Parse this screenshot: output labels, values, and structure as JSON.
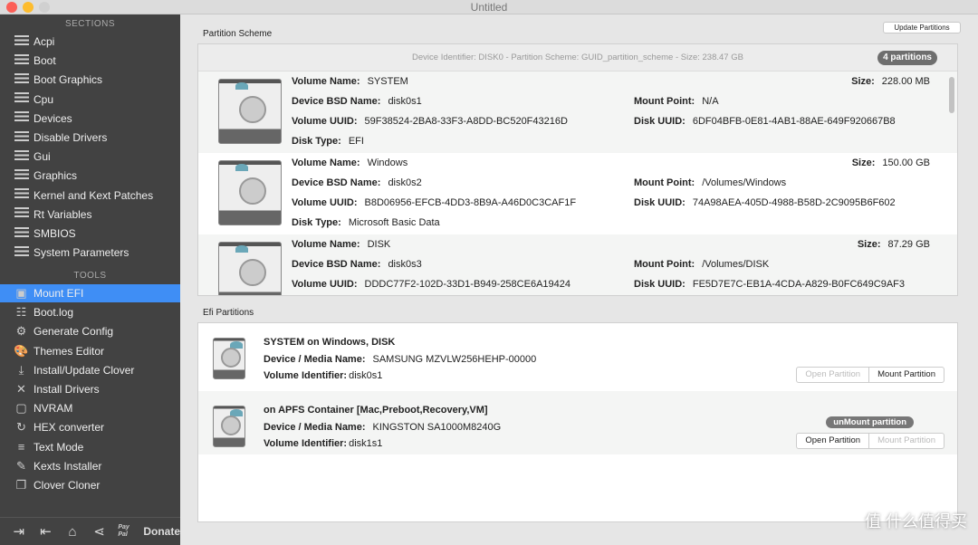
{
  "window": {
    "title": "Untitled"
  },
  "sidebar": {
    "sections_header": "SECTIONS",
    "sections": [
      "Acpi",
      "Boot",
      "Boot Graphics",
      "Cpu",
      "Devices",
      "Disable Drivers",
      "Gui",
      "Graphics",
      "Kernel and Kext Patches",
      "Rt Variables",
      "SMBIOS",
      "System Parameters"
    ],
    "tools_header": "TOOLS",
    "tools": [
      {
        "label": "Mount EFI",
        "icon": "mount-efi-icon",
        "selected": true
      },
      {
        "label": "Boot.log",
        "icon": "log-search-icon"
      },
      {
        "label": "Generate Config",
        "icon": "gears-icon"
      },
      {
        "label": "Themes Editor",
        "icon": "palette-icon"
      },
      {
        "label": "Install/Update Clover",
        "icon": "download-icon"
      },
      {
        "label": "Install Drivers",
        "icon": "tools-icon"
      },
      {
        "label": "NVRAM",
        "icon": "chip-icon"
      },
      {
        "label": "HEX converter",
        "icon": "refresh-icon"
      },
      {
        "label": "Text Mode",
        "icon": "text-lines-icon"
      },
      {
        "label": "Kexts Installer",
        "icon": "plug-icon"
      },
      {
        "label": "Clover Cloner",
        "icon": "copy-icon"
      }
    ],
    "footer": {
      "donate": "Donate",
      "paypal": "Pay Pal"
    },
    "accent": "#3f8ef5"
  },
  "toolbar": {
    "update_partitions": "Update Partitions"
  },
  "partition_scheme": {
    "label": "Partition Scheme",
    "header": "Device Identifier: DISK0 - Partition Scheme: GUID_partition_scheme - Size: 238.47 GB",
    "badge": "4 partitions",
    "keys": {
      "volume_name": "Volume Name:",
      "bsd": "Device BSD Name:",
      "uuid": "Volume UUID:",
      "disk_type": "Disk Type:",
      "size": "Size:",
      "mount": "Mount Point:",
      "disk_uuid": "Disk UUID:"
    },
    "partitions": [
      {
        "volume_name": "SYSTEM",
        "bsd": "disk0s1",
        "uuid": "59F38524-2BA8-33F3-A8DD-BC520F43216D",
        "disk_type": "EFI",
        "size": "228.00 MB",
        "mount": "N/A",
        "disk_uuid": "6DF04BFB-0E81-4AB1-88AE-649F920667B8"
      },
      {
        "volume_name": "Windows",
        "bsd": "disk0s2",
        "uuid": "B8D06956-EFCB-4DD3-8B9A-A46D0C3CAF1F",
        "disk_type": "Microsoft Basic Data",
        "size": "150.00 GB",
        "mount": "/Volumes/Windows",
        "disk_uuid": "74A98AEA-405D-4988-B58D-2C9095B6F602"
      },
      {
        "volume_name": "DISK",
        "bsd": "disk0s3",
        "uuid": "DDDC77F2-102D-33D1-B949-258CE6A19424",
        "size": "87.29 GB",
        "mount": "/Volumes/DISK",
        "disk_uuid": "FE5D7E7C-EB1A-4CDA-A829-B0FC649C9AF3"
      }
    ]
  },
  "efi": {
    "label": "Efi Partitions",
    "keys": {
      "media": "Device / Media Name:",
      "vid": "Volume Identifier:"
    },
    "open": "Open Partition",
    "mount": "Mount Partition",
    "unmount": "unMount partition",
    "items": [
      {
        "title": "SYSTEM on Windows, DISK",
        "media": "SAMSUNG MZVLW256HEHP-00000",
        "vid": "disk0s1",
        "mounted": false
      },
      {
        "title": "on APFS Container [Mac,Preboot,Recovery,VM]",
        "media": "KINGSTON SA1000M8240G",
        "vid": "disk1s1",
        "mounted": true
      }
    ]
  },
  "watermark": "值 什么值得买"
}
